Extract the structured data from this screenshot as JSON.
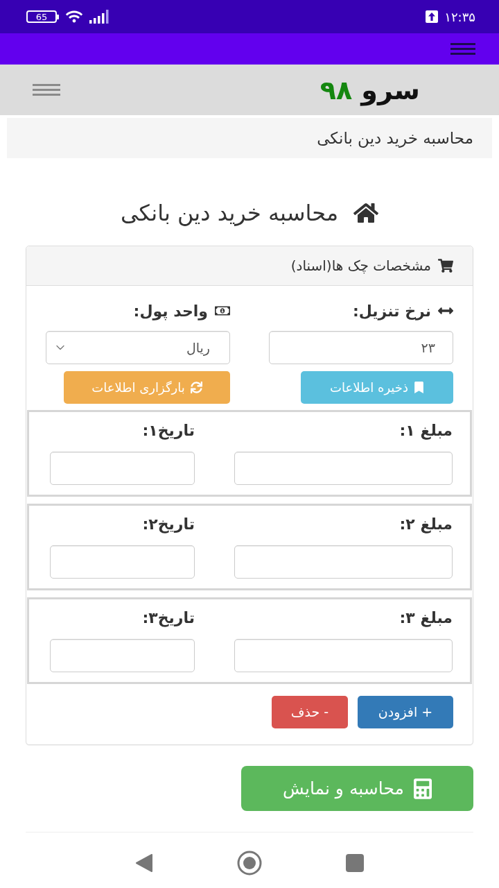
{
  "status_bar": {
    "battery": "65",
    "time": "۱۲:۳۵"
  },
  "site_header": {
    "logo_name": "سرو",
    "logo_number": "۹۸"
  },
  "breadcrumb": {
    "current": "محاسبه خرید دین بانکی"
  },
  "page_title": "محاسبه خرید دین بانکی",
  "panel": {
    "title": "مشخصات چک ها(اسناد)",
    "settings": [
      {
        "kind": "input",
        "label": "نرخ تنزیل:",
        "value": "۲۳"
      },
      {
        "kind": "select",
        "label": "واحد پول:",
        "value": "ریال"
      }
    ],
    "action_buttons": [
      {
        "kind": "save",
        "label": "ذخیره اطلاعات"
      },
      {
        "kind": "load",
        "label": "بارگزاری اطلاعات"
      }
    ],
    "checks": [
      {
        "amount_label": "مبلغ ۱:",
        "date_label": "تاریخ۱:"
      },
      {
        "amount_label": "مبلغ ۲:",
        "date_label": "تاریخ۲:"
      },
      {
        "amount_label": "مبلغ ۳:",
        "date_label": "تاریخ۳:"
      }
    ],
    "row_buttons": [
      {
        "kind": "add",
        "label": "+ افزودن"
      },
      {
        "kind": "remove",
        "label": "- حذف"
      }
    ]
  },
  "calculate_button": {
    "label": "محاسبه و نمایش"
  }
}
